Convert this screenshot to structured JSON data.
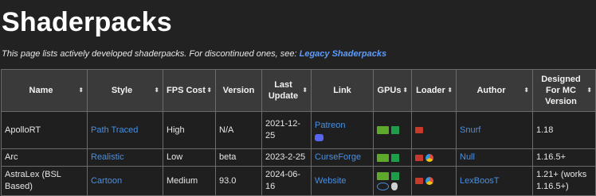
{
  "page": {
    "title": "Shaderpacks",
    "intro_text": "This page lists actively developed shaderpacks. For discontinued ones, see:",
    "intro_link": "Legacy Shaderpacks"
  },
  "table": {
    "sort_arrow": "⬍",
    "headers": [
      {
        "label": "Name",
        "sortable": true
      },
      {
        "label": "Style",
        "sortable": true
      },
      {
        "label": "FPS Cost",
        "sortable": true
      },
      {
        "label": "Version",
        "sortable": false
      },
      {
        "label": "Last Update",
        "sortable": true
      },
      {
        "label": "Link",
        "sortable": false
      },
      {
        "label": "GPUs",
        "sortable": true
      },
      {
        "label": "Loader",
        "sortable": true
      },
      {
        "label": "Author",
        "sortable": true
      },
      {
        "label": "Designed For MC Version",
        "sortable": true
      }
    ],
    "rows": [
      {
        "name": "ApolloRT",
        "style": "Path Traced",
        "fps_cost": "High",
        "version": "N/A",
        "last_update": "2021-12-25",
        "link": "Patreon",
        "link_extra_icon": "discord-icon",
        "gpu_icons": [
          "nvidia-icon",
          "amd-icon"
        ],
        "loader_icons": [
          "optifine-icon"
        ],
        "author": "Snurf",
        "mc_version": "1.18"
      },
      {
        "name": "Arc",
        "style": "Realistic",
        "fps_cost": "Low",
        "version": "beta",
        "last_update": "2023-2-25",
        "link": "CurseForge",
        "gpu_icons": [
          "nvidia-icon",
          "amd-icon"
        ],
        "loader_icons": [
          "optifine-icon",
          "iris-icon"
        ],
        "author": "Null",
        "mc_version": "1.16.5+"
      },
      {
        "name": "AstraLex (BSL Based)",
        "style": "Cartoon",
        "fps_cost": "Medium",
        "version": "93.0",
        "last_update": "2024-06-16",
        "link": "Website",
        "gpu_icons": [
          "nvidia-icon",
          "amd-icon",
          "intel-icon",
          "apple-icon"
        ],
        "loader_icons": [
          "optifine-icon",
          "iris-icon"
        ],
        "author": "LexBoosT",
        "mc_version": "1.21+ (works 1.16.5+)"
      }
    ]
  },
  "colors": {
    "background": "#222222",
    "header_bg": "#3a3a3a",
    "link": "#4a8fe0",
    "border": "#6b6b6b"
  }
}
